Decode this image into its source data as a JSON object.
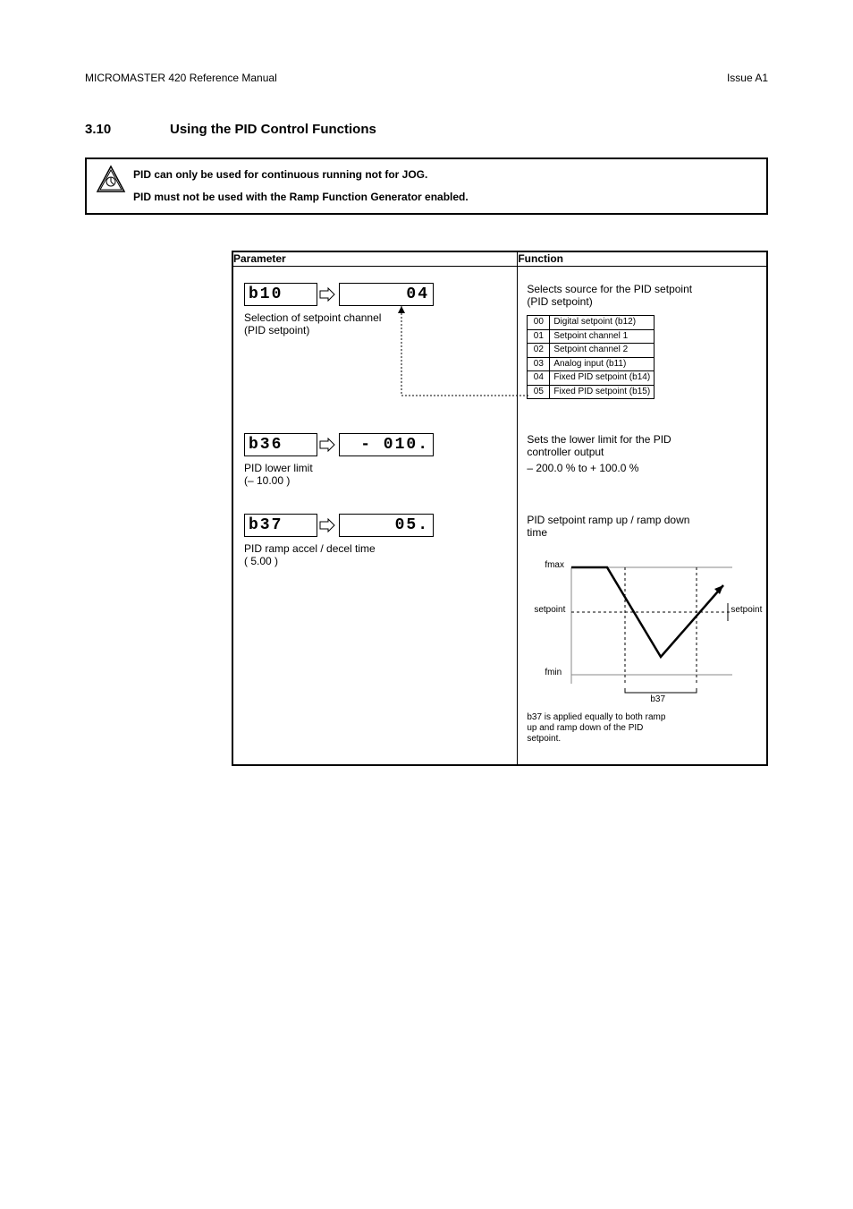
{
  "header_left": "MICROMASTER 420 Reference Manual",
  "header_right": "Issue A1",
  "section_num": "3.10",
  "section_title": "Using the PID Control Functions",
  "note_line": "PID can only be used for continuous running not for JOG.",
  "note_sub": "PID must not be used with the Ramp Function Generator enabled.",
  "col_parameter": "Parameter",
  "col_function": "Function",
  "row1": {
    "code": "b10",
    "val": "04",
    "caption_line1": "Selection of setpoint channel",
    "caption_line2": "(PID setpoint)",
    "fn_line1": "Selects source for the PID setpoint",
    "fn_line2": "(PID setpoint)"
  },
  "options": [
    {
      "c": "00",
      "t": "Digital setpoint (b12)"
    },
    {
      "c": "01",
      "t": "Setpoint channel 1"
    },
    {
      "c": "02",
      "t": "Setpoint channel 2"
    },
    {
      "c": "03",
      "t": "Analog input (b11)"
    },
    {
      "c": "04",
      "t": "Fixed PID setpoint (b14)"
    },
    {
      "c": "05",
      "t": "Fixed PID setpoint (b15)"
    }
  ],
  "row2": {
    "code": "b36",
    "val": "- 010.",
    "caption_line1": "PID lower limit",
    "caption_line2": "(– 10.00 )",
    "fn_line1": "Sets the lower limit for the PID",
    "fn_line2": "controller output",
    "fn_line3": "– 200.0 % to + 100.0 %"
  },
  "row3": {
    "code": "b37",
    "val": "05.",
    "caption_line1": "PID ramp accel / decel time",
    "caption_line2": "( 5.00 )",
    "fn_line1": "PID setpoint ramp up / ramp down",
    "fn_line2": "time"
  },
  "graph": {
    "y_top": "fmax",
    "y_line": "setpoint",
    "y_bot": "fmin",
    "x_span": "b37",
    "side": "setpoint",
    "caption": "b37 is applied equally to both ramp",
    "caption2": "up and ramp down of the PID",
    "caption3": "setpoint."
  }
}
